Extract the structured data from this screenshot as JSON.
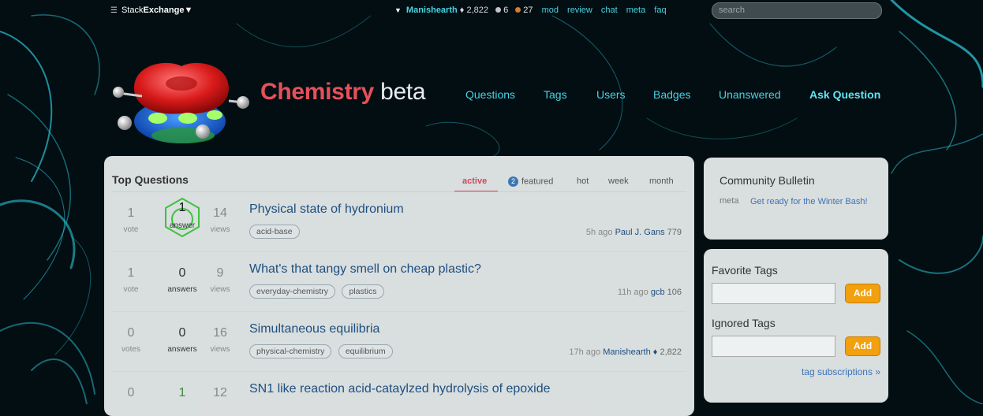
{
  "topbar": {
    "se_prefix": "Stack",
    "se_bold": "Exchange",
    "username": "Manishearth",
    "reputation": "2,822",
    "silver_badges": "6",
    "bronze_badges": "27",
    "links": [
      "mod",
      "review",
      "chat",
      "meta",
      "faq"
    ],
    "search_placeholder": "search"
  },
  "header": {
    "site_name": "Chemistry",
    "beta": "beta",
    "nav": [
      "Questions",
      "Tags",
      "Users",
      "Badges",
      "Unanswered"
    ],
    "ask": "Ask Question"
  },
  "main": {
    "title": "Top Questions",
    "tabs": {
      "active": "active",
      "featured_count": "2",
      "featured": "featured",
      "hot": "hot",
      "week": "week",
      "month": "month"
    },
    "questions": [
      {
        "votes": "1",
        "votes_label": "vote",
        "answers": "1",
        "answers_label": "answer",
        "views": "14",
        "views_label": "views",
        "title": "Physical state of hydronium",
        "tags": [
          "acid-base"
        ],
        "time": "5h ago",
        "user": "Paul J. Gans",
        "rep": "779"
      },
      {
        "votes": "1",
        "votes_label": "vote",
        "answers": "0",
        "answers_label": "answers",
        "views": "9",
        "views_label": "views",
        "title": "What's that tangy smell on cheap plastic?",
        "tags": [
          "everyday-chemistry",
          "plastics"
        ],
        "time": "11h ago",
        "user": "gcb",
        "rep": "106"
      },
      {
        "votes": "0",
        "votes_label": "votes",
        "answers": "0",
        "answers_label": "answers",
        "views": "16",
        "views_label": "views",
        "title": "Simultaneous equilibria",
        "tags": [
          "physical-chemistry",
          "equilibrium"
        ],
        "time": "17h ago",
        "user": "Manishearth ♦",
        "rep": "2,822"
      },
      {
        "votes": "0",
        "answers": "1",
        "views": "12",
        "title": "SN1 like reaction acid-cataylzed hydrolysis of epoxide"
      }
    ]
  },
  "sidebar": {
    "bulletin_title": "Community Bulletin",
    "bulletin_label": "meta",
    "bulletin_link": "Get ready for the Winter Bash!",
    "favorite_tags": "Favorite Tags",
    "ignored_tags": "Ignored Tags",
    "add": "Add",
    "subscriptions": "tag subscriptions »"
  },
  "colors": {
    "accent": "#45d3e6",
    "site_red": "#e6505a",
    "add_button": "#f2a00d",
    "accepted_green": "#3a8c3a"
  }
}
